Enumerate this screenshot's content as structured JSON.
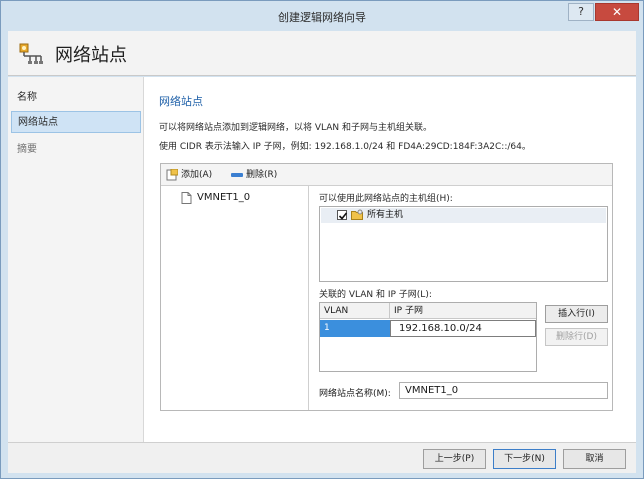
{
  "window": {
    "title": "创建逻辑网络向导",
    "help_glyph": "?",
    "close_glyph": "✕"
  },
  "header": {
    "title": "网络站点",
    "icon": "network-site-icon"
  },
  "nav": {
    "items": [
      {
        "label": "名称",
        "selected": false
      },
      {
        "label": "网络站点",
        "selected": true
      },
      {
        "label": "摘要",
        "selected": false
      }
    ]
  },
  "main": {
    "section_title": "网络站点",
    "description_1": "可以将网络站点添加到逻辑网络，以将 VLAN 和子网与主机组关联。",
    "description_2": "使用 CIDR 表示法输入 IP 子网，例如: 192.168.1.0/24 和 FD4A:29CD:184F:3A2C::/64。",
    "toolbar": {
      "add_label": "添加(A)",
      "remove_label": "删除(R)"
    },
    "sites": [
      {
        "label": "VMNET1_0"
      }
    ],
    "hostgroups_label": "可以使用此网络站点的主机组(H):",
    "hostgroups": [
      {
        "label": "所有主机",
        "checked": true
      }
    ],
    "vlan_label": "关联的 VLAN 和 IP 子网(L):",
    "vlan_table": {
      "headers": [
        "VLAN",
        "IP 子网"
      ],
      "rows": [
        {
          "vlan": "1",
          "subnet": "192.168.10.0/24"
        }
      ]
    },
    "insert_row_label": "插入行(I)",
    "delete_row_label": "删除行(D)",
    "site_name_label": "网络站点名称(M):",
    "site_name_value": "VMNET1_0"
  },
  "footer": {
    "prev_label": "上一步(P)",
    "next_label": "下一步(N)",
    "cancel_label": "取消"
  },
  "colors": {
    "title_bar": "#d2e2ef",
    "accent": "#1d5fa8",
    "selection": "#3b8fdd",
    "close": "#c74a3f"
  }
}
